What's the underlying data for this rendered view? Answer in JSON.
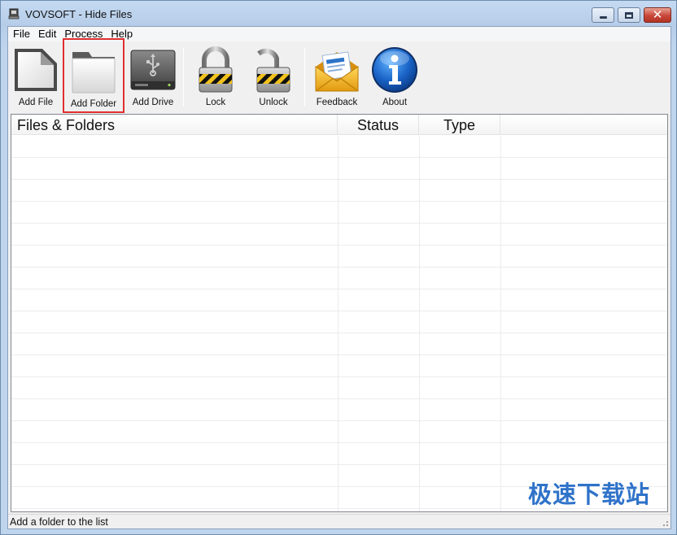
{
  "window": {
    "title": "VOVSOFT - Hide Files",
    "controls": {
      "minimize": "minimize",
      "maximize": "maximize",
      "close": "✕"
    }
  },
  "menu": [
    "File",
    "Edit",
    "Process",
    "Help"
  ],
  "toolbar": {
    "add_file": "Add File",
    "add_folder": "Add Folder",
    "add_drive": "Add Drive",
    "lock": "Lock",
    "unlock": "Unlock",
    "feedback": "Feedback",
    "about": "About",
    "selected": "add_folder",
    "highlight_color": "#e03030"
  },
  "list": {
    "columns": [
      "Files & Folders",
      "Status",
      "Type"
    ],
    "rows": []
  },
  "statusbar": {
    "text": "Add a folder to the list"
  },
  "watermark": "极速下载站",
  "colors": {
    "accent": "#1a63c7",
    "title_bar": "#bcd3ec"
  }
}
